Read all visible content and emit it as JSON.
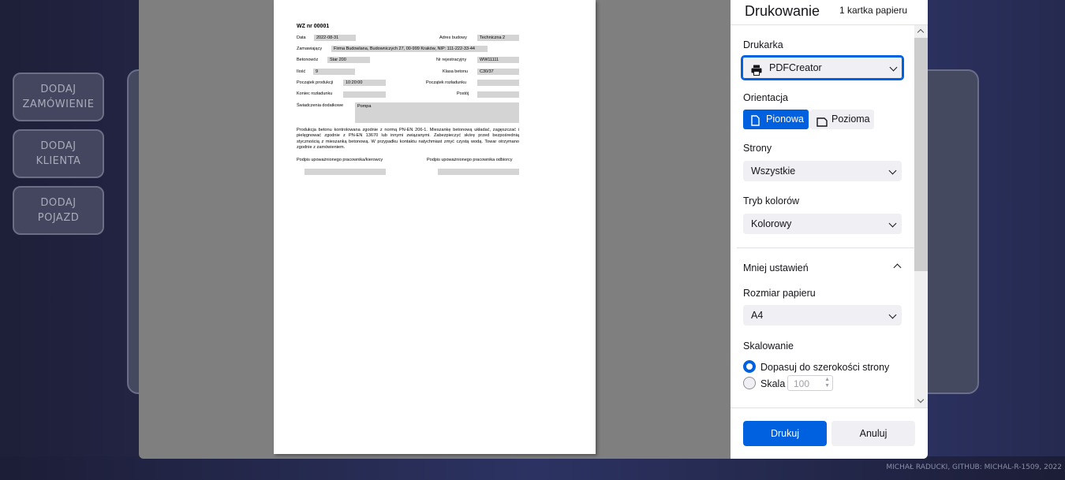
{
  "sidebar": {
    "buttons": [
      {
        "line1": "DODAJ",
        "line2": "ZAMÓWIENIE"
      },
      {
        "line1": "DODAJ",
        "line2": "KLIENTA"
      },
      {
        "line1": "DODAJ",
        "line2": "POJAZD"
      }
    ]
  },
  "footer": {
    "credit": "MICHAŁ RADUCKI, GITHUB: MICHAL-R-1509, 2022"
  },
  "document": {
    "title": "WZ nr 00001",
    "data_label": "Data",
    "data_value": "2022-08-31",
    "adres_label": "Adres budowy",
    "adres_value": "Techniczna 2",
    "zamawiajacy_label": "Zamawiający",
    "zamawiajacy_value": "Firma Budowlana, Budowniczych 27, 00-999 Kraków, NIP: 111-222-33-44",
    "betonowoz_label": "Betonowóz",
    "betonowoz_value": "Star 200",
    "nr_rej_label": "Nr rejestracyjny",
    "nr_rej_value": "WW11111",
    "ilosc_label": "Ilość",
    "ilosc_value": "9",
    "klasa_label": "Klasa betonu",
    "klasa_value": "C30/37",
    "pocz_prod_label": "Początek produkcji",
    "pocz_prod_value": "10:20:00",
    "pocz_rozl_label": "Początek rozładunku",
    "pocz_rozl_value": "",
    "koniec_rozl_label": "Koniec rozładunku",
    "koniec_rozl_value": "",
    "postoj_label": "Postój",
    "postoj_value": "",
    "swiadczenia_label": "Świadczenia dodatkowe",
    "swiadczenia_value": "Pompa",
    "paragraph": "Produkcja betonu kontrolowana zgodnie z normą PN-EN 206-1. Mieszankę betonową układać, zagęszczać i pielęgnować zgodnie z PN-EN 13670 lub innymi związanymi. Zabezpieczyć skórę przed bezpośrednią stycznością z mieszanką betonową. W przypadku kontaktu natychmiast zmyć czystą wodą. Towar otrzymano zgodnie z zamówieniem.",
    "sig_left": "Podpis upoważnionego pracownika/kierowcy",
    "sig_right": "Podpis upoważnionego pracownika odbiorcy"
  },
  "print_dialog": {
    "title": "Drukowanie",
    "sheets": "1 kartka papieru",
    "printer_label": "Drukarka",
    "printer_value": "PDFCreator",
    "orientation_label": "Orientacja",
    "orientation_portrait": "Pionowa",
    "orientation_landscape": "Pozioma",
    "pages_label": "Strony",
    "pages_value": "Wszystkie",
    "color_label": "Tryb kolorów",
    "color_value": "Kolorowy",
    "less_settings": "Mniej ustawień",
    "paper_label": "Rozmiar papieru",
    "paper_value": "A4",
    "scaling_label": "Skalowanie",
    "scaling_fit": "Dopasuj do szerokości strony",
    "scaling_scale": "Skala",
    "scale_placeholder": "100",
    "print_button": "Drukuj",
    "cancel_button": "Anuluj",
    "accent_color": "#0061e0"
  }
}
